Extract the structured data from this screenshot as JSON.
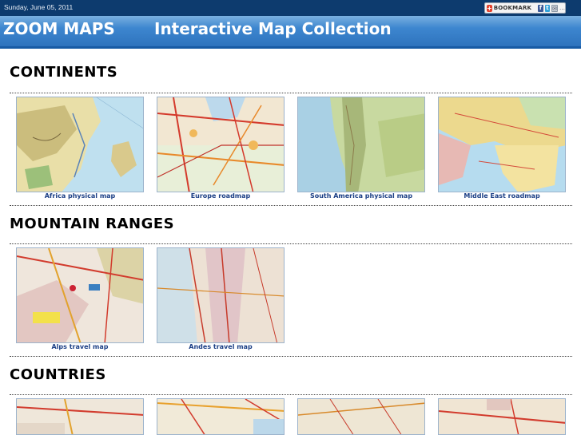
{
  "topbar": {
    "date": "Sunday, June 05, 2011",
    "bookmark_label": "BOOKMARK",
    "share_icons": [
      "facebook-icon",
      "twitter-icon",
      "email-icon"
    ]
  },
  "header": {
    "brand": "ZOOM MAPS",
    "tagline": "Interactive Map Collection"
  },
  "sections": [
    {
      "title": "CONTINENTS",
      "maps": [
        {
          "caption": "Africa physical map"
        },
        {
          "caption": "Europe roadmap"
        },
        {
          "caption": "South America physical map"
        },
        {
          "caption": "Middle East roadmap"
        }
      ]
    },
    {
      "title": "MOUNTAIN RANGES",
      "maps": [
        {
          "caption": "Alps travel map"
        },
        {
          "caption": "Andes travel map"
        }
      ]
    },
    {
      "title": "COUNTRIES",
      "maps": [
        {
          "caption": ""
        },
        {
          "caption": ""
        },
        {
          "caption": ""
        },
        {
          "caption": ""
        }
      ]
    }
  ],
  "colors": {
    "topbar": "#0d3b6e",
    "header": "#3d86cf",
    "caption": "#1b3f86"
  }
}
